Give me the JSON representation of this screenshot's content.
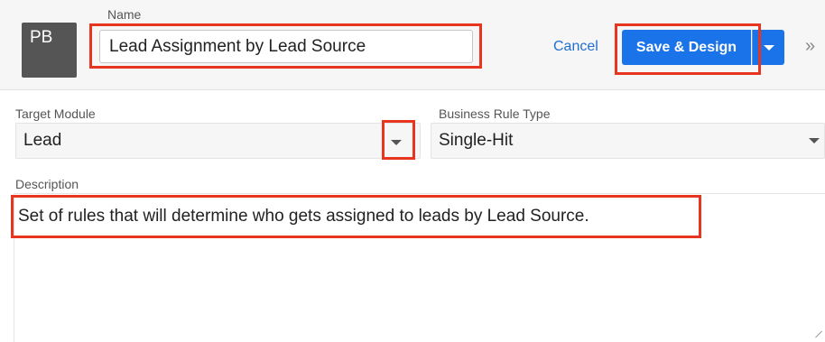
{
  "header": {
    "avatar_initials": "PB",
    "name_label": "Name",
    "name_value": "Lead Assignment by Lead Source",
    "cancel_label": "Cancel",
    "save_label": "Save & Design",
    "expand_glyph": "»"
  },
  "form": {
    "target_module": {
      "label": "Target Module",
      "value": "Lead"
    },
    "business_rule_type": {
      "label": "Business Rule Type",
      "value": "Single-Hit"
    },
    "description": {
      "label": "Description",
      "value": "Set of rules that will determine who gets assigned to leads by Lead Source."
    }
  },
  "colors": {
    "primary": "#1a73e8",
    "link": "#1f6fd1",
    "highlight": "#e8351f",
    "avatar_bg": "#555555"
  }
}
